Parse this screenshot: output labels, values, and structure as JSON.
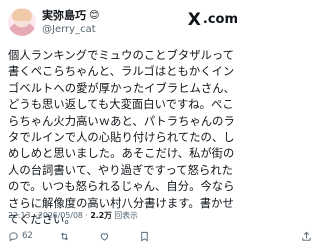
{
  "author": {
    "name": "実弥島巧",
    "name_emoji": "😊",
    "handle": "@Jerry_cat"
  },
  "brand": {
    "logo_text": ".com",
    "logo_mark": "X"
  },
  "tweet": {
    "text": "個人ランキングでミュウのことブタザルって書くペこらちゃんと、ラルゴはともかくインゴベルトへの愛が厚かったイブラヒムさん、どうも思い返しても大変面白いですね。ぺこらちゃん火力高いｗあと、パトラちゃんのラタでルインで人の心貼り付けられてたの、しめしめと思いました。あそこだけ、私が街の人の台詞書いて、やり過ぎですって怒られたので。いつも怒られるじゃん、自分。今ならさらに解像度の高い村八分書けます。書かせてください。"
  },
  "meta": {
    "time": "22:13",
    "separator1": " · ",
    "date": "2026/05/08",
    "separator2": " · ",
    "views_count": "2.2万",
    "views_label": "回表示"
  },
  "actions": {
    "reply_count": "62",
    "retweet_count": "",
    "like_count": "",
    "bookmark_count": ""
  }
}
